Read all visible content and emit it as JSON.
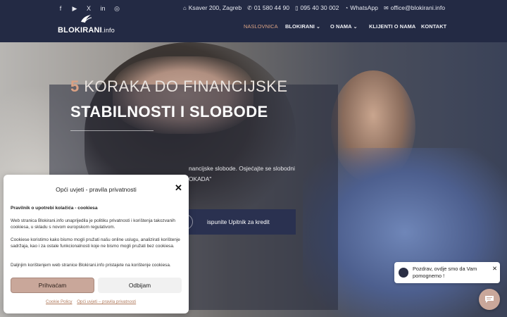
{
  "header": {
    "social": [
      "f",
      "▶",
      "X",
      "in",
      "◎"
    ],
    "contacts": [
      {
        "icon": "home-icon",
        "glyph": "⌂",
        "text": "Ksaver 200, Zagreb"
      },
      {
        "icon": "phone-icon",
        "glyph": "✆",
        "text": "01 580 44 90"
      },
      {
        "icon": "mobile-icon",
        "glyph": "▯",
        "text": "095 40 30 002"
      },
      {
        "icon": "whatsapp-icon",
        "glyph": "◔",
        "text": "WhatsApp"
      },
      {
        "icon": "mail-icon",
        "glyph": "✉",
        "text": "office@blokirani.info"
      }
    ],
    "logo_main": "BLOKIRANI",
    "logo_suffix": ".info",
    "nav": [
      "NASLOVNICA",
      "BLOKIRANI",
      "O NAMA",
      "KLIJENTI O NAMA",
      "KONTAKT"
    ]
  },
  "hero": {
    "title_num": "5",
    "title_line1": " KORAKA DO FINANCIJSKE",
    "title_line2": "STABILNOSTI I SLOBODE",
    "text_line1": "nancijske slobode. Osjećajte se slobodni",
    "text_line2": "OKADA\"",
    "cta_label": "ispunite Upitnik za kredit"
  },
  "cookie": {
    "title": "Opći uvjeti - pravila privatnosti",
    "subtitle": "Pravilnik o upotrebi kolačića - cookiesa",
    "p1": "Web stranica Blokirani.info unaprijedila je politiku privatnosti i korištenja takozvanih cookiesa, u skladu s novom europskom regulativom.",
    "p2": "Cookiese koristimo kako bismo mogli pružati našu online uslugu, analizirati korištenje sadržaja, kao i za ostale funkcionalnosti koje ne bismo mogli pružati bez cookiesa.",
    "p3": "Daljnjim korištenjem web stranice Blokirani.info pristajete na korištenje cookiesa.",
    "accept": "Prihvaćam",
    "deny": "Odbijam",
    "link1": "Cookie Policy",
    "link2": "Opći uvjeti – pravila privatnosti"
  },
  "chat": {
    "line1": "Pozdrav, ovdje smo da Vam",
    "line2": "pomognemo !"
  },
  "colors": {
    "accent": "#d9a184",
    "header_bg": "#232a44",
    "button": "#c9a79a"
  }
}
